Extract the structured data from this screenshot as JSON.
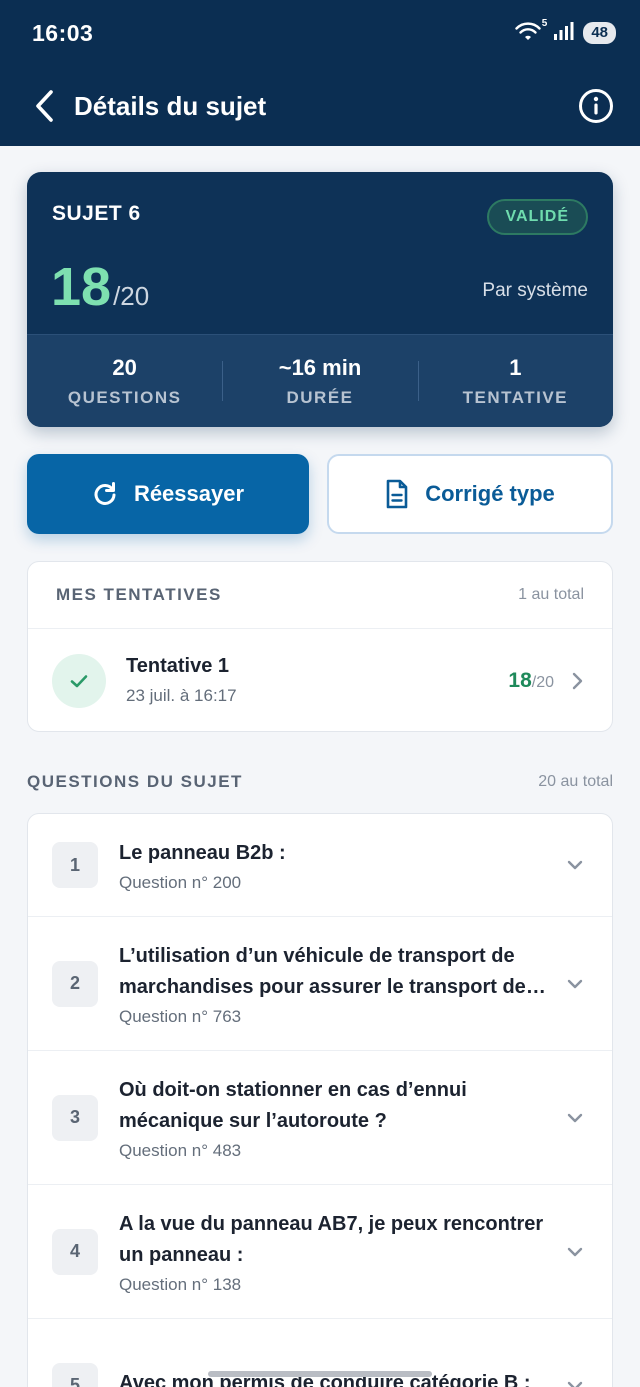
{
  "status": {
    "time": "16:03",
    "battery": "48",
    "wifi_sub": "5"
  },
  "header": {
    "title": "Détails du sujet"
  },
  "summary": {
    "subject_label": "SUJET 6",
    "badge": "VALIDÉ",
    "score": "18",
    "score_total": "/20",
    "graded_by": "Par système",
    "stats": [
      {
        "value": "20",
        "label": "QUESTIONS"
      },
      {
        "value": "~16 min",
        "label": "DURÉE"
      },
      {
        "value": "1",
        "label": "TENTATIVE"
      }
    ]
  },
  "actions": {
    "retry_label": "Réessayer",
    "corrige_label": "Corrigé type"
  },
  "attempts": {
    "title": "MES TENTATIVES",
    "count": "1 au total",
    "items": [
      {
        "title": "Tentative 1",
        "date": "23 juil. à 16:17",
        "score": "18",
        "score_total": "/20"
      }
    ]
  },
  "questions": {
    "title": "QUESTIONS DU SUJET",
    "count": "20 au total",
    "items": [
      {
        "num": "1",
        "title": "Le panneau B2b :",
        "sub": "Question n° 200"
      },
      {
        "num": "2",
        "title": "L’utilisation d’un véhicule de transport de marchandises pour assurer le transport de personnes",
        "sub": "Question n° 763"
      },
      {
        "num": "3",
        "title": "Où doit-on stationner en cas d’ennui mécanique sur l’autoroute ?",
        "sub": "Question n° 483"
      },
      {
        "num": "4",
        "title": "A la vue du panneau AB7, je peux rencontrer un panneau :",
        "sub": "Question n° 138"
      },
      {
        "num": "5",
        "title": "Avec mon permis de conduire catégorie B :",
        "sub": ""
      }
    ]
  },
  "colors": {
    "primary": "#0b2e52",
    "accent": "#0765a6",
    "success": "#1f8a5b",
    "score_green": "#7ee0b0"
  }
}
